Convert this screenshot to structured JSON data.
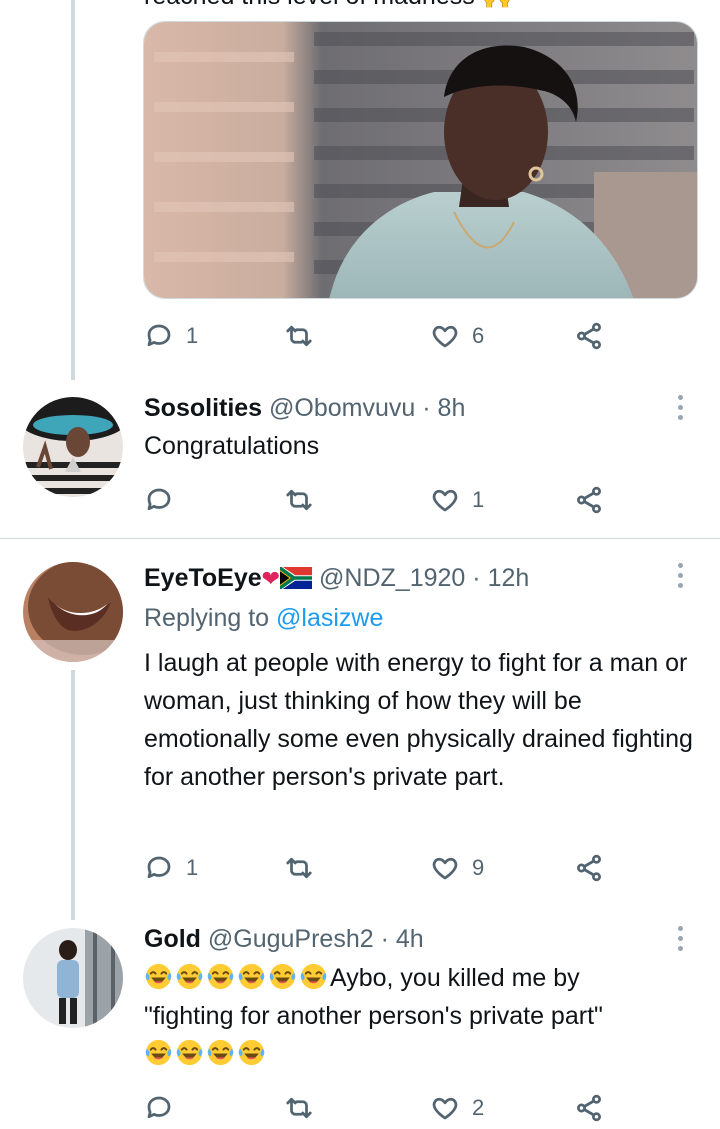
{
  "top_tweet": {
    "cut_text": "reached this level of madness 🙌",
    "stats": {
      "replies": "1",
      "retweets": "",
      "likes": "6"
    }
  },
  "replies": [
    {
      "name": "Sosolities",
      "handle": "@Obomvuvu",
      "time": "8h",
      "text": "Congratulations",
      "stats": {
        "replies": "",
        "retweets": "",
        "likes": "1"
      }
    },
    {
      "name": "EyeToEye",
      "name_emoji": "💖",
      "handle": "@NDZ_1920",
      "time": "12h",
      "replying_prefix": "Replying to",
      "replying_to": "@lasizwe",
      "text": "I laugh at people with energy to fight for a man or woman, just thinking of how they will be emotionally some even physically drained fighting for another person's private part.",
      "stats": {
        "replies": "1",
        "retweets": "",
        "likes": "9"
      }
    },
    {
      "name": "Gold",
      "handle": "@GuguPresh2",
      "time": "4h",
      "text_line1": "Aybo, you killed me by",
      "text_line2": "\"fighting for another person's private part\"",
      "stats": {
        "replies": "",
        "retweets": "",
        "likes": "2"
      }
    }
  ],
  "separator": "·",
  "icons": [
    "reply-icon",
    "retweet-icon",
    "like-icon",
    "share-icon",
    "more-icon",
    "laughing-emoji-icon",
    "sparkling-heart-emoji",
    "south-africa-flag"
  ],
  "colors": {
    "secondary_text": "#536471",
    "link": "#1d9bf0",
    "divider": "#cfd9de"
  }
}
